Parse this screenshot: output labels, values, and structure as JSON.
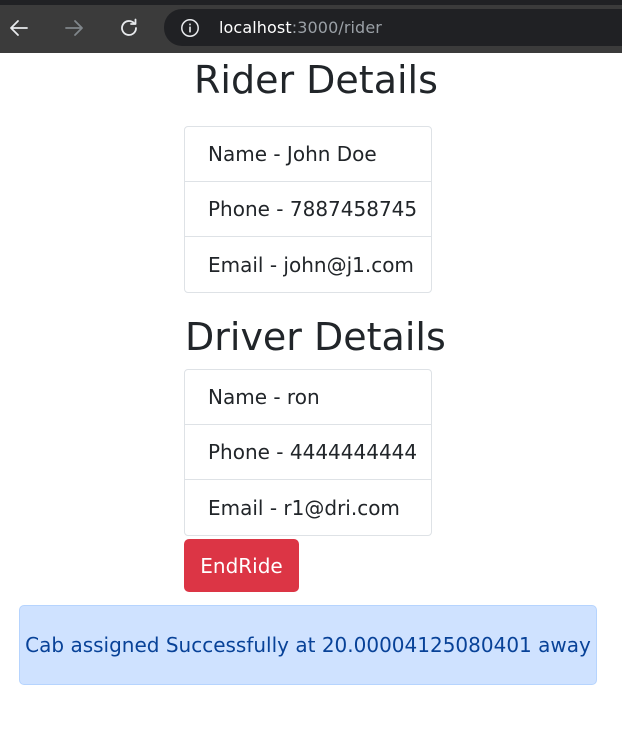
{
  "browser": {
    "url_host": "localhost",
    "url_rest": ":3000/rider",
    "icons": {
      "back": "back-arrow-icon",
      "forward": "forward-arrow-icon",
      "reload": "reload-icon",
      "info": "info-icon"
    }
  },
  "rider": {
    "title": "Rider Details",
    "name": "Name - John Doe",
    "phone": "Phone - 7887458745",
    "email": "Email - john@j1.com"
  },
  "driver": {
    "title": "Driver Details",
    "name": "Name - ron",
    "phone": "Phone - 4444444444",
    "email": "Email - r1@dri.com"
  },
  "actions": {
    "end_ride_label": "EndRide"
  },
  "alert": {
    "message": "Cab assigned Successfully at 20.00004125080401 away"
  },
  "colors": {
    "danger": "#dc3545",
    "alert_bg": "#cfe2ff",
    "alert_text": "#084298",
    "text": "#212529",
    "border": "#dee2e6"
  }
}
